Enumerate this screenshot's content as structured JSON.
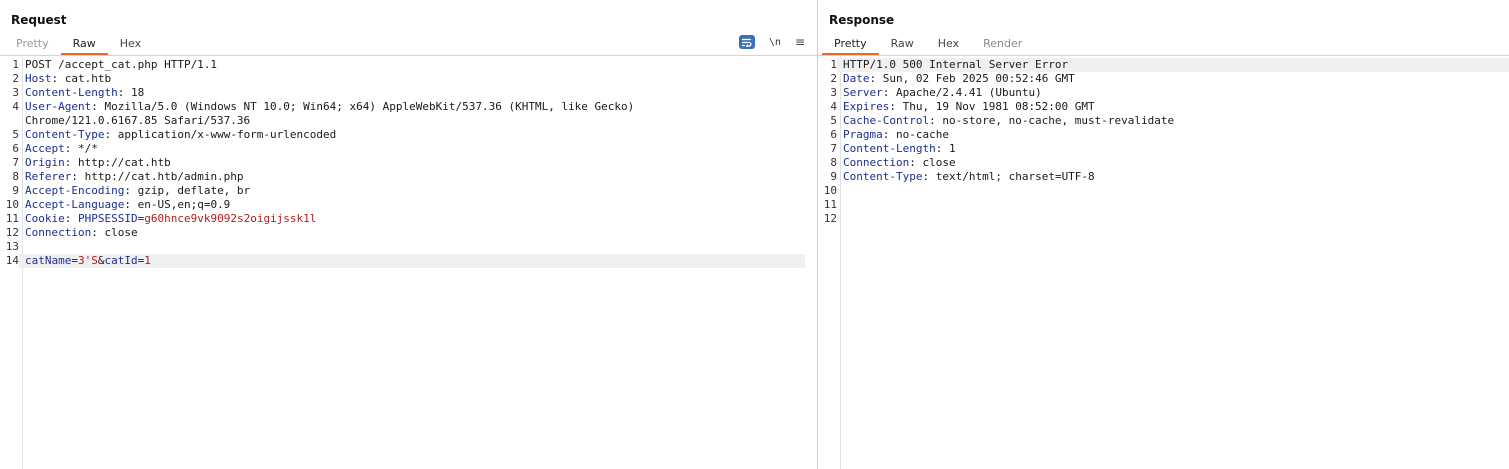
{
  "request": {
    "title": "Request",
    "tabs": [
      "Pretty",
      "Raw",
      "Hex"
    ],
    "active_tab": "Raw",
    "tools": {
      "newline_label": "\\n",
      "menu_label": "≡"
    },
    "lines": [
      {
        "no": "1",
        "text": "POST /accept_cat.php HTTP/1.1"
      },
      {
        "no": "2",
        "key": "Host",
        "sep": ": ",
        "value": "cat.htb"
      },
      {
        "no": "3",
        "key": "Content-Length",
        "sep": ": ",
        "value": "18"
      },
      {
        "no": "4",
        "key": "User-Agent",
        "sep": ": ",
        "value": "Mozilla/5.0 (Windows NT 10.0; Win64; x64) AppleWebKit/537.36 (KHTML, like Gecko)"
      },
      {
        "no": "",
        "text": "Chrome/121.0.6167.85 Safari/537.36"
      },
      {
        "no": "5",
        "key": "Content-Type",
        "sep": ": ",
        "value": "application/x-www-form-urlencoded"
      },
      {
        "no": "6",
        "key": "Accept",
        "sep": ": ",
        "value": "*/*"
      },
      {
        "no": "7",
        "key": "Origin",
        "sep": ": ",
        "value": "http://cat.htb"
      },
      {
        "no": "8",
        "key": "Referer",
        "sep": ": ",
        "value": "http://cat.htb/admin.php"
      },
      {
        "no": "9",
        "key": "Accept-Encoding",
        "sep": ": ",
        "value": "gzip, deflate, br"
      },
      {
        "no": "10",
        "key": "Accept-Language",
        "sep": ": ",
        "value": "en-US,en;q=0.9"
      },
      {
        "no": "11",
        "key": "Cookie",
        "sep": ": ",
        "value": "",
        "ckey": "PHPSESSID",
        "ceq": "=",
        "cval": "g60hnce9vk9092s2oigijssk1l"
      },
      {
        "no": "12",
        "key": "Connection",
        "sep": ": ",
        "value": "close"
      },
      {
        "no": "13",
        "text": ""
      },
      {
        "no": "14",
        "highlight": true,
        "p1k": "catName",
        "p1eq": "=",
        "p1v": "3'S",
        "amp": "&",
        "p2k": "catId",
        "p2eq": "=",
        "p2v": "1"
      }
    ]
  },
  "response": {
    "title": "Response",
    "tabs": [
      "Pretty",
      "Raw",
      "Hex",
      "Render"
    ],
    "active_tab": "Pretty",
    "lines": [
      {
        "no": "1",
        "highlight": true,
        "text": "HTTP/1.0 500 Internal Server Error"
      },
      {
        "no": "2",
        "key": "Date",
        "sep": ": ",
        "value": "Sun, 02 Feb 2025 00:52:46 GMT"
      },
      {
        "no": "3",
        "key": "Server",
        "sep": ": ",
        "value": "Apache/2.4.41 (Ubuntu)"
      },
      {
        "no": "4",
        "key": "Expires",
        "sep": ": ",
        "value": "Thu, 19 Nov 1981 08:52:00 GMT"
      },
      {
        "no": "5",
        "key": "Cache-Control",
        "sep": ": ",
        "value": "no-store, no-cache, must-revalidate"
      },
      {
        "no": "6",
        "key": "Pragma",
        "sep": ": ",
        "value": "no-cache"
      },
      {
        "no": "7",
        "key": "Content-Length",
        "sep": ": ",
        "value": "1"
      },
      {
        "no": "8",
        "key": "Connection",
        "sep": ": ",
        "value": "close"
      },
      {
        "no": "9",
        "key": "Content-Type",
        "sep": ": ",
        "value": "text/html; charset=UTF-8"
      },
      {
        "no": "10",
        "text": ""
      },
      {
        "no": "11",
        "text": ""
      },
      {
        "no": "12",
        "text": ""
      }
    ]
  },
  "colors": {
    "key": "#1c2f8f",
    "param_value": "#b01c1c",
    "accent": "#e8682f",
    "wrap_button": "#3c6fb6"
  }
}
